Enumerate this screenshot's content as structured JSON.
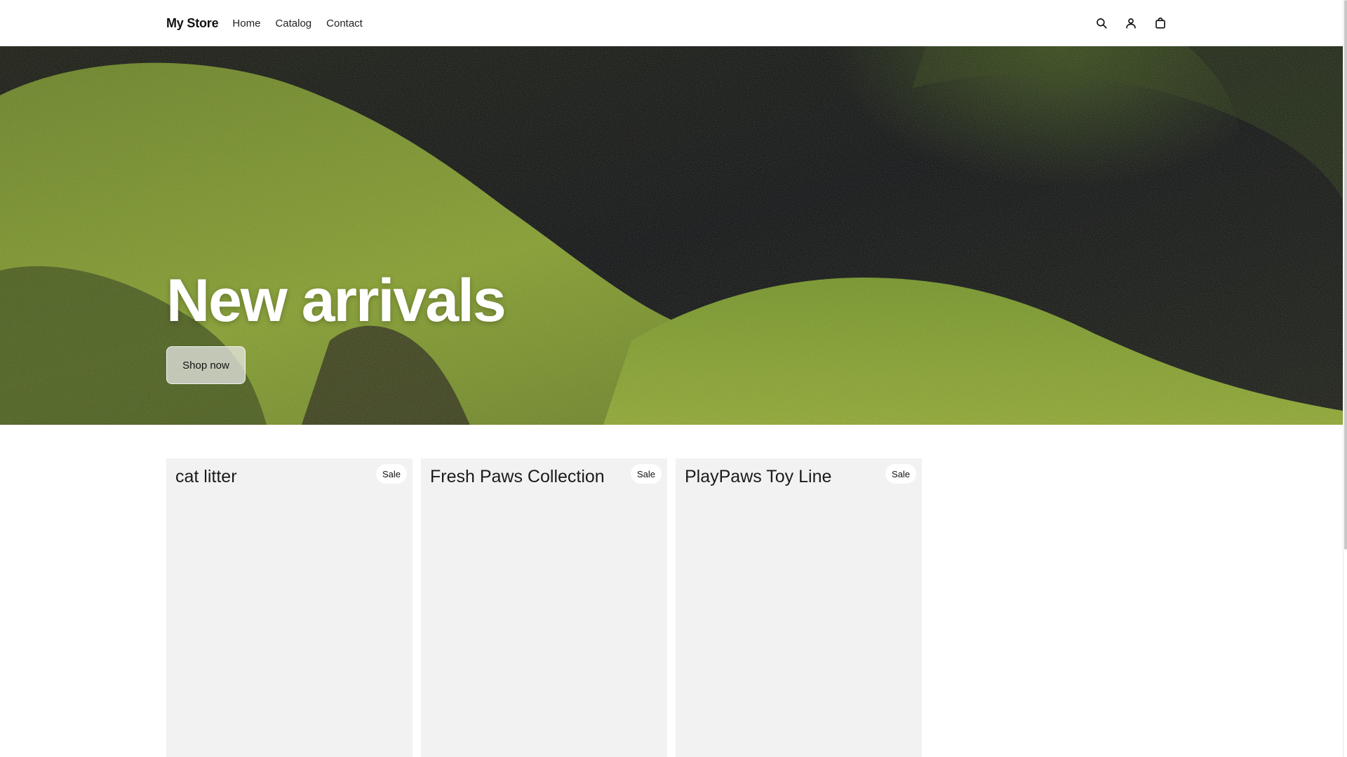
{
  "header": {
    "brand": "My Store",
    "nav": [
      {
        "label": "Home"
      },
      {
        "label": "Catalog"
      },
      {
        "label": "Contact"
      }
    ],
    "icons": [
      "search-icon",
      "account-icon",
      "cart-icon"
    ]
  },
  "hero": {
    "title": "New arrivals",
    "button_label": "Shop now",
    "image_description_colors": {
      "moss_light": "#8fae2a",
      "moss_dark": "#3d5214",
      "shadow": "#0b0d09"
    }
  },
  "products": [
    {
      "title": "cat litter",
      "badge": "Sale"
    },
    {
      "title": "Fresh Paws Collection",
      "badge": "Sale"
    },
    {
      "title": "PlayPaws Toy Line",
      "badge": "Sale"
    }
  ],
  "colors": {
    "card_bg": "#f2f2f2",
    "text": "#111111",
    "badge_bg": "#ffffff"
  }
}
